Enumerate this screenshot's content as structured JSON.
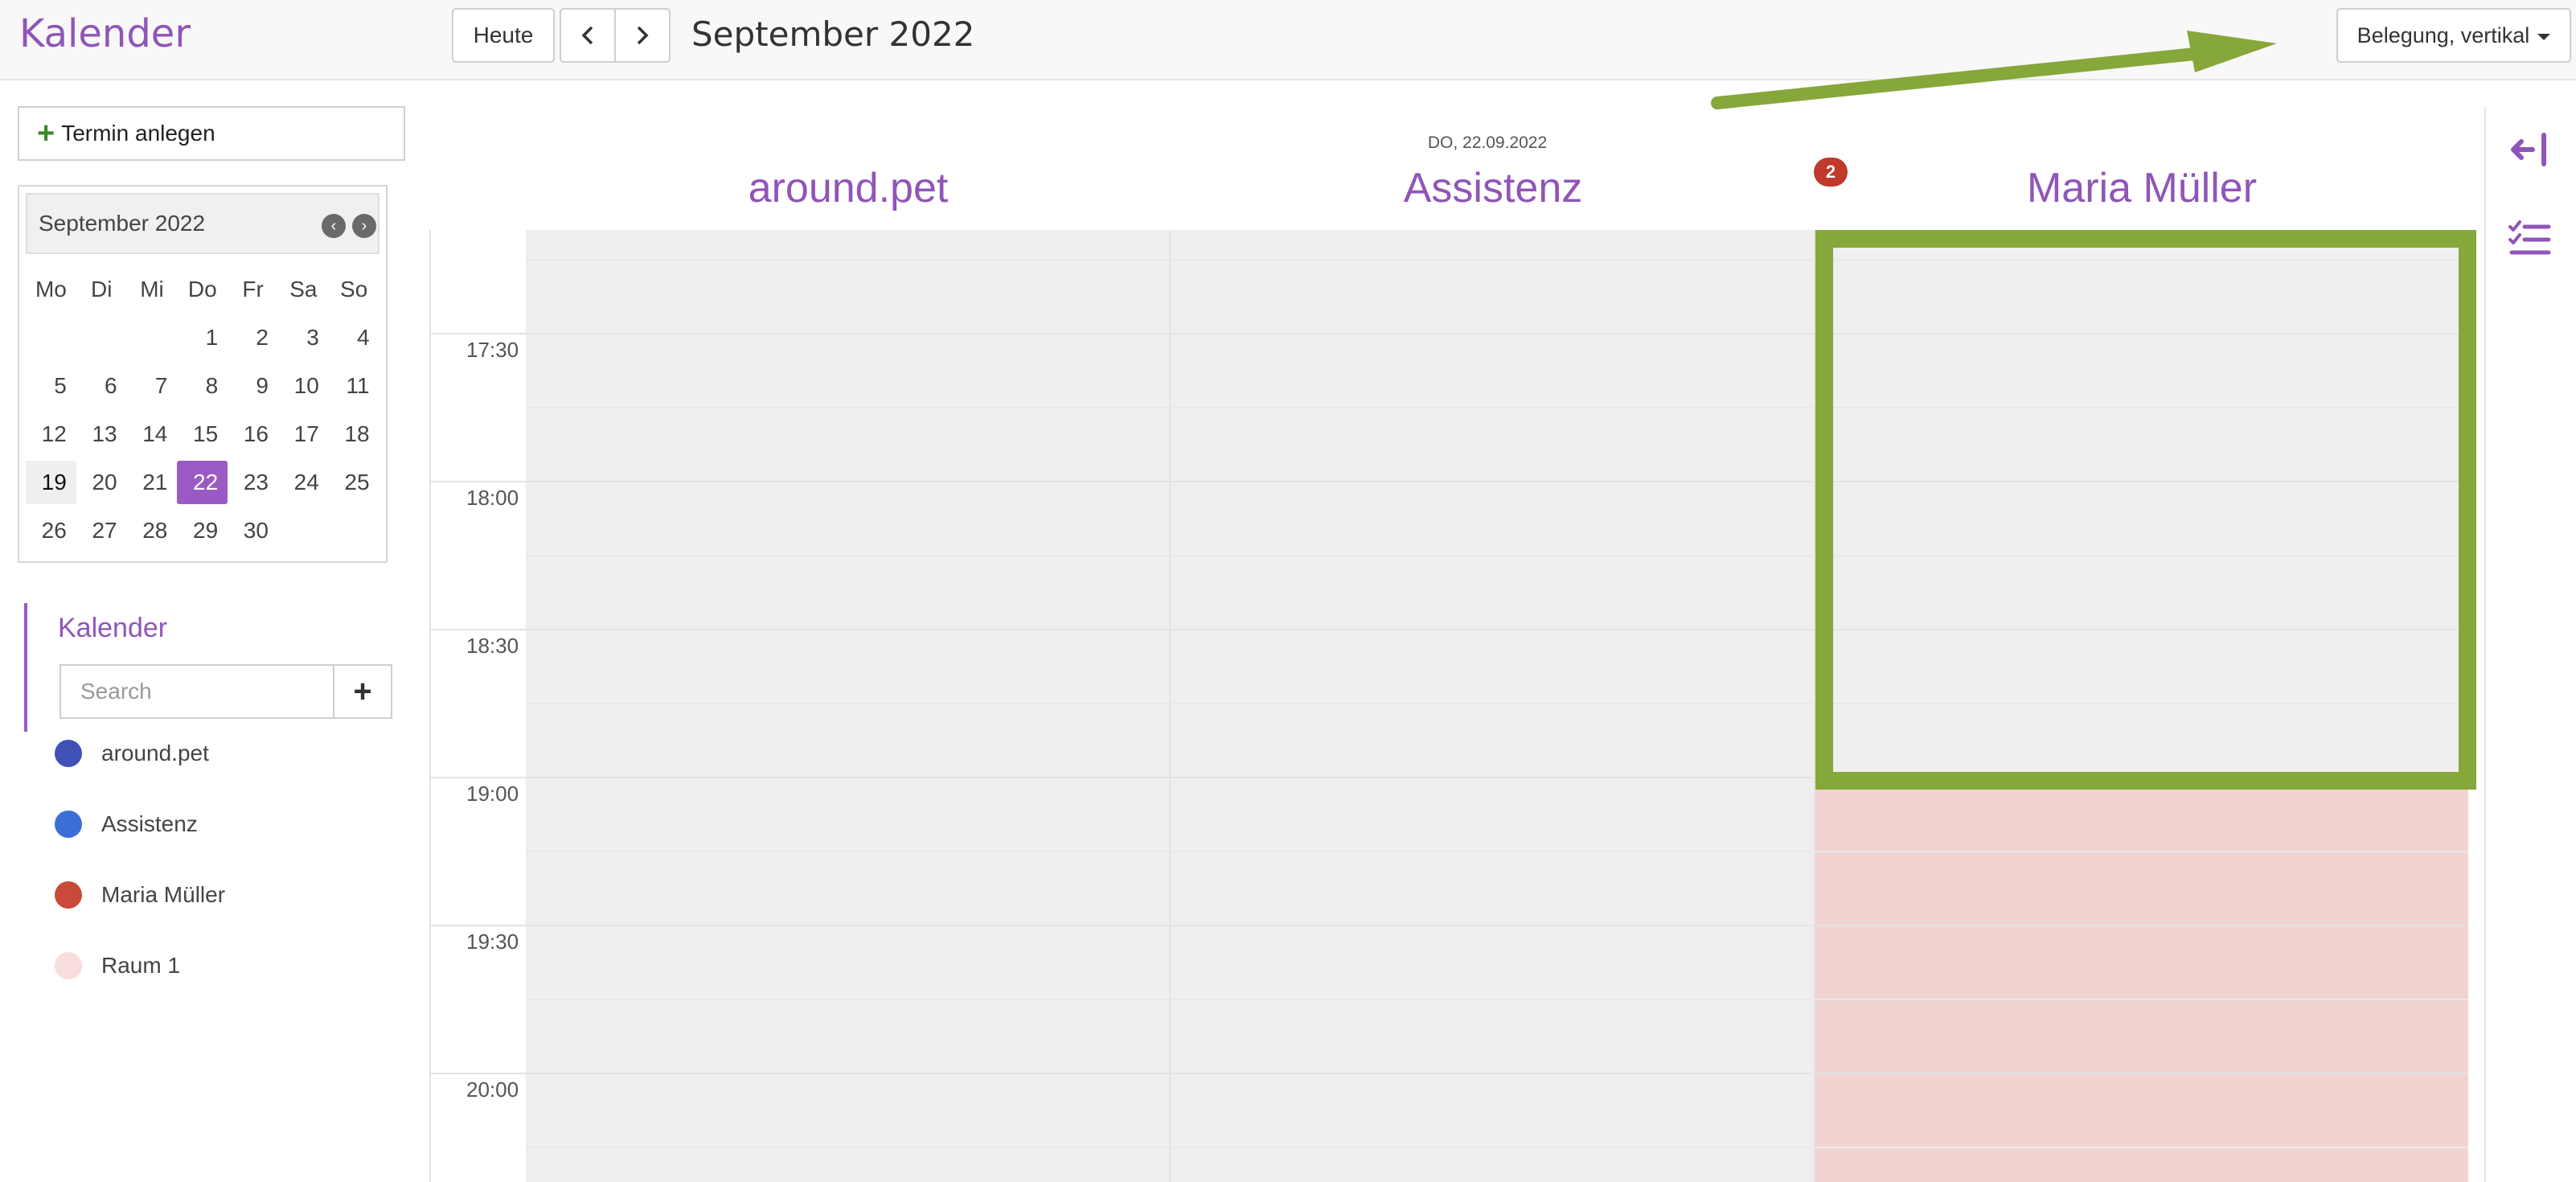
{
  "header": {
    "app_title": "Kalender",
    "today_label": "Heute",
    "month_title": "September 2022",
    "view_label": "Belegung, vertikal"
  },
  "sidebar": {
    "new_appointment_label": "Termin anlegen",
    "mini_calendar": {
      "title": "September 2022",
      "weekdays": [
        "Mo",
        "Di",
        "Mi",
        "Do",
        "Fr",
        "Sa",
        "So"
      ],
      "weeks": [
        [
          "",
          "",
          "",
          "1",
          "2",
          "3",
          "4"
        ],
        [
          "5",
          "6",
          "7",
          "8",
          "9",
          "10",
          "11"
        ],
        [
          "12",
          "13",
          "14",
          "15",
          "16",
          "17",
          "18"
        ],
        [
          "19",
          "20",
          "21",
          "22",
          "23",
          "24",
          "25"
        ],
        [
          "26",
          "27",
          "28",
          "29",
          "30",
          "",
          ""
        ]
      ],
      "selected_day": "22",
      "highlighted_day": "19"
    },
    "calendars_title": "Kalender",
    "search_placeholder": "Search",
    "calendars": [
      {
        "name": "around.pet",
        "color": "#3f51b5"
      },
      {
        "name": "Assistenz",
        "color": "#3b6fd6"
      },
      {
        "name": "Maria Müller",
        "color": "#c94a3a"
      },
      {
        "name": "Raum 1",
        "color": "#f7dedd"
      }
    ]
  },
  "main": {
    "date_label": "DO, 22.09.2022",
    "resources": [
      "around.pet",
      "Assistenz",
      "Maria Müller"
    ],
    "badge_count": "2",
    "time_labels": [
      "17:30",
      "18:00",
      "18:30",
      "19:00",
      "19:30",
      "20:00"
    ]
  },
  "colors": {
    "accent": "#9055b8",
    "annotation": "#86a73a",
    "blocked": "#f1d4d2",
    "badge": "#c0392b"
  },
  "icons": [
    "chevron-left-icon",
    "chevron-right-icon",
    "caret-down-icon",
    "plus-icon",
    "collapse-left-icon",
    "checklist-icon"
  ]
}
